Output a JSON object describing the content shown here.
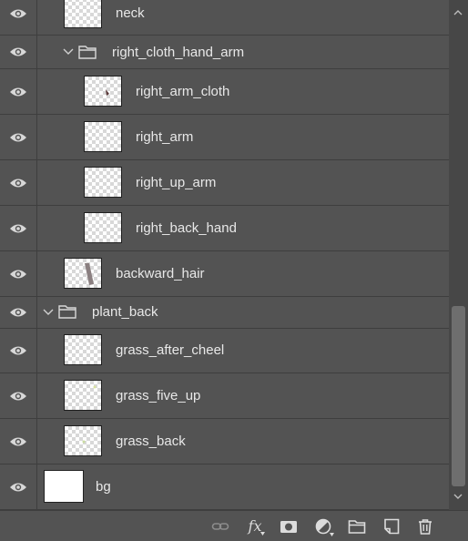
{
  "layers": [
    {
      "name": "neck"
    },
    {
      "name": "right_cloth_hand_arm"
    },
    {
      "name": "right_arm_cloth"
    },
    {
      "name": "right_arm"
    },
    {
      "name": "right_up_arm"
    },
    {
      "name": "right_back_hand"
    },
    {
      "name": "backward_hair"
    },
    {
      "name": "plant_back"
    },
    {
      "name": "grass_after_cheel"
    },
    {
      "name": "grass_five_up"
    },
    {
      "name": "grass_back"
    },
    {
      "name": "bg"
    }
  ],
  "footer": {
    "fx_label": "fx",
    "icons": [
      "link-icon",
      "fx-icon",
      "mask-icon",
      "adjustment-icon",
      "folder-icon",
      "new-layer-icon",
      "trash-icon"
    ]
  }
}
